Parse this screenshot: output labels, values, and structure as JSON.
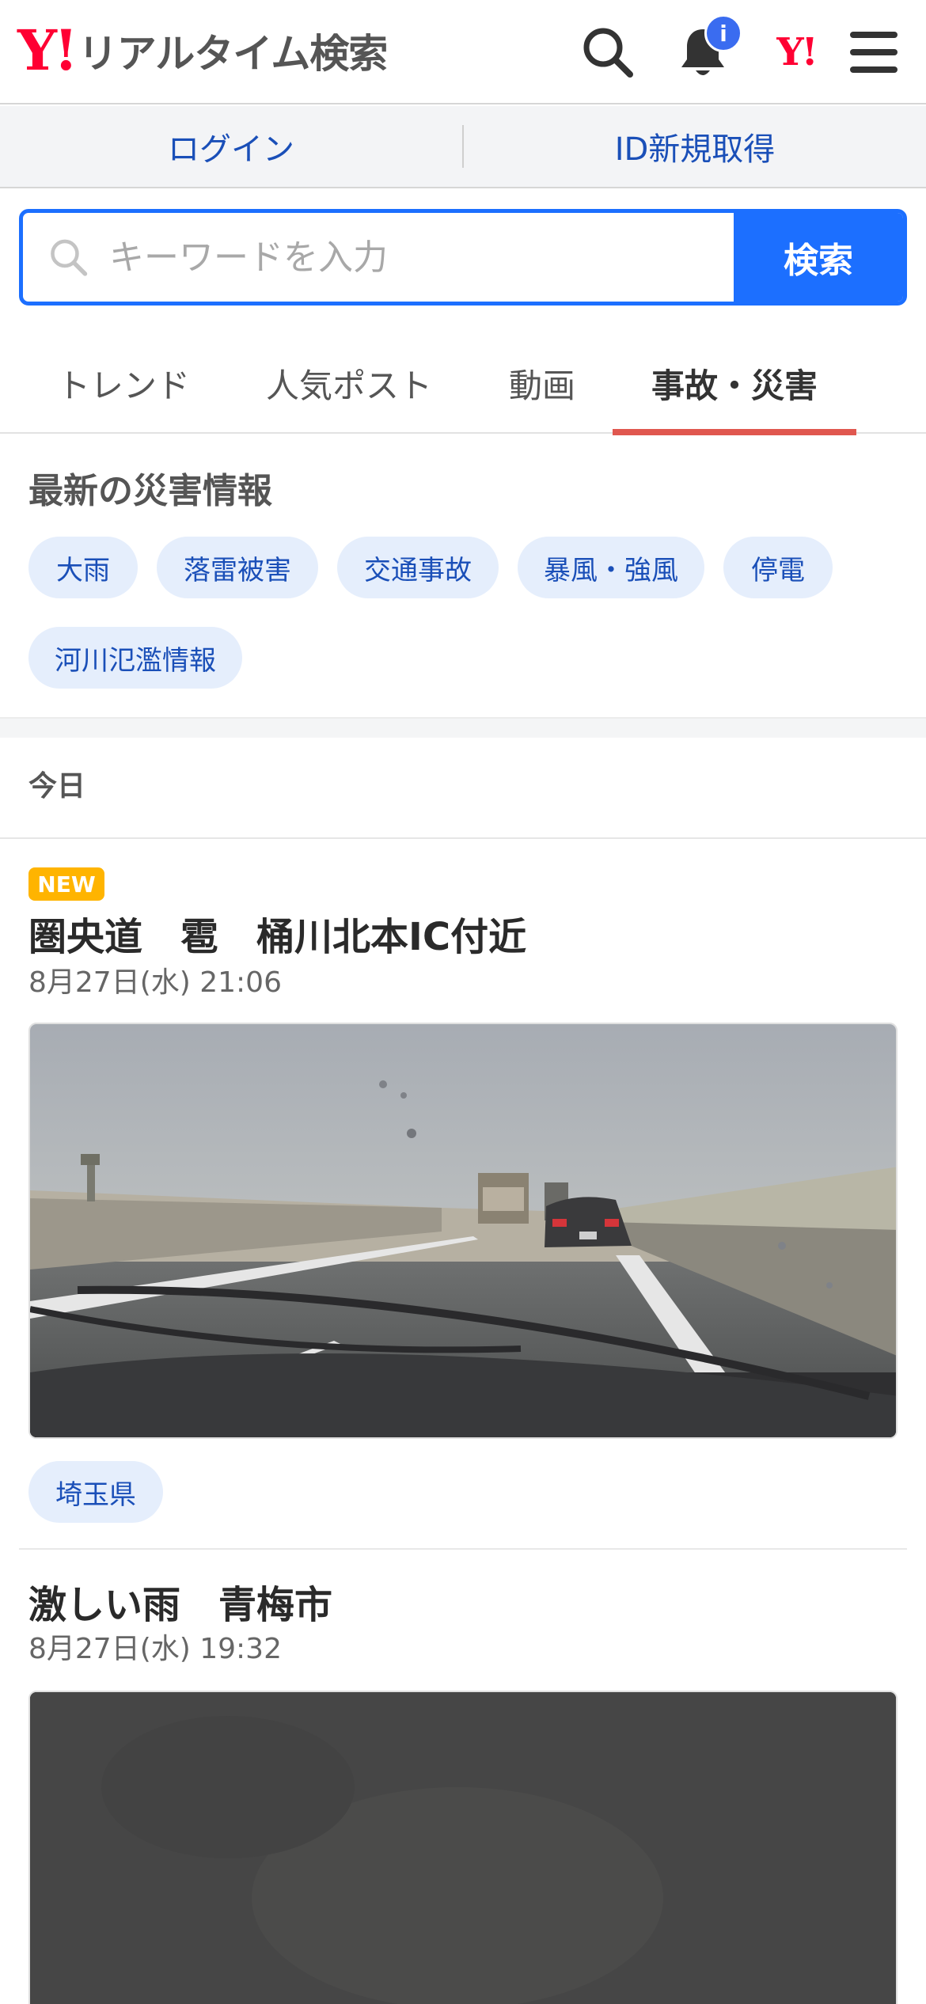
{
  "header": {
    "logo_mark": "Y!",
    "logo_text": "リアルタイム検索",
    "notification_badge": "i",
    "yahoo_mark": "Y!"
  },
  "account": {
    "login": "ログイン",
    "register": "ID新規取得"
  },
  "search": {
    "placeholder": "キーワードを入力",
    "button": "検索",
    "accent_color": "#1c6fff"
  },
  "tabs": [
    {
      "label": "トレンド",
      "active": false
    },
    {
      "label": "人気ポスト",
      "active": false
    },
    {
      "label": "動画",
      "active": false
    },
    {
      "label": "事故・災害",
      "active": true
    }
  ],
  "disaster": {
    "heading": "最新の災害情報",
    "chips": [
      "大雨",
      "落雷被害",
      "交通事故",
      "暴風・強風",
      "停電",
      "河川氾濫情報"
    ]
  },
  "feed": {
    "day_label": "今日",
    "posts": [
      {
        "badge": "NEW",
        "title": "圏央道　雹　桶川北本IC付近",
        "date": "8月27日(水) 21:06",
        "tag": "埼玉県"
      },
      {
        "title": "激しい雨　青梅市",
        "date": "8月27日(水) 19:32"
      }
    ]
  }
}
